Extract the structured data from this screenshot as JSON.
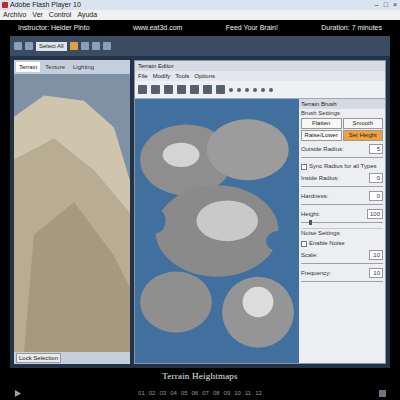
{
  "window": {
    "title": "Adobe Flash Player 10",
    "buttons": [
      "–",
      "□",
      "×"
    ]
  },
  "menu": [
    "Archivo",
    "Ver",
    "Control",
    "Ayuda"
  ],
  "header": {
    "instructor": "Instructor: Helder Pinto",
    "site": "www.eat3d.com",
    "slogan": "Feed Your Brain!",
    "duration": "Duration: 7 minutes"
  },
  "app": {
    "toolbar_select": "Select All",
    "tabs": [
      {
        "label": "Terrain",
        "selected": true
      },
      {
        "label": "Texture",
        "selected": false
      },
      {
        "label": "Lighting",
        "selected": false
      }
    ],
    "lock_button": "Lock Selection"
  },
  "terrain_editor": {
    "title": "Terrain Editor",
    "menu": [
      "File",
      "Modify",
      "Tools",
      "Options"
    ],
    "panel_title": "Terrain Brush",
    "section": "Brush Settings",
    "brush_types": [
      {
        "label": "Flatten",
        "selected": false
      },
      {
        "label": "Smooth",
        "selected": false
      },
      {
        "label": "Raise/Lower",
        "selected": false
      },
      {
        "label": "Set Height",
        "selected": true
      }
    ],
    "fields": [
      {
        "kind": "number",
        "label": "Outside Radius:",
        "value": "5"
      },
      {
        "kind": "checkbox",
        "label": "Sync Radius for all Types",
        "checked": false
      },
      {
        "kind": "number",
        "label": "Inside Radius:",
        "value": "0"
      },
      {
        "kind": "number",
        "label": "Hardness:",
        "value": "0"
      },
      {
        "kind": "slider",
        "label": "Height:",
        "value": "100",
        "level": 0.1
      },
      {
        "kind": "section",
        "label": "Noise Settings"
      },
      {
        "kind": "checkbox",
        "label": "Enable Noise",
        "checked": false
      },
      {
        "kind": "number",
        "label": "Scale:",
        "value": "10"
      },
      {
        "kind": "number",
        "label": "Frequency:",
        "value": "10"
      }
    ]
  },
  "video_title": "Terrain Heightmaps",
  "chapters": [
    "01",
    "02",
    "03",
    "04",
    "05",
    "06",
    "07",
    "08",
    "09",
    "10",
    "11",
    "12"
  ]
}
